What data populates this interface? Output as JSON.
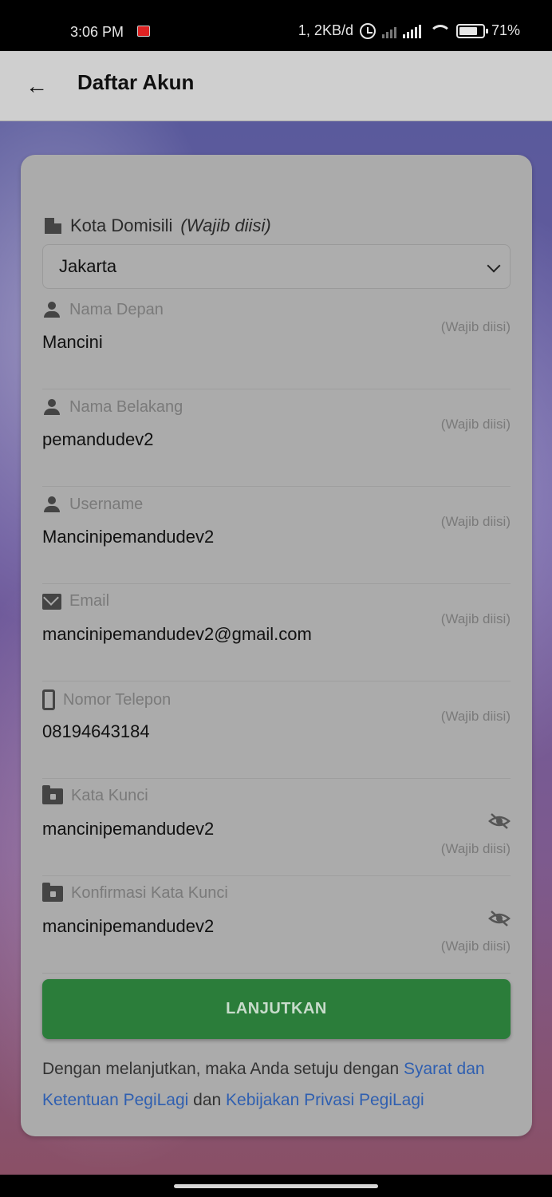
{
  "status_bar": {
    "time": "3:06 PM",
    "network_speed": "1, 2KB/d",
    "battery": "71%"
  },
  "app_bar": {
    "title": "Daftar Akun",
    "back_icon": "arrow-left-icon"
  },
  "form": {
    "city": {
      "label": "Kota Domisili",
      "required_note": "(Wajib diisi)",
      "value": "Jakarta",
      "icon": "building-icon"
    },
    "fields": [
      {
        "label": "Nama Depan",
        "value": "Mancini",
        "required": "(Wajib diisi)",
        "icon": "person-icon"
      },
      {
        "label": "Nama Belakang",
        "value": "pemandudev2",
        "required": "(Wajib diisi)",
        "icon": "person-icon"
      },
      {
        "label": "Username",
        "value": "Mancinipemandudev2",
        "required": "(Wajib diisi)",
        "icon": "person-icon"
      },
      {
        "label": "Email",
        "value": "mancinipemandudev2@gmail.com",
        "required": "(Wajib diisi)",
        "icon": "mail-icon"
      },
      {
        "label": "Nomor Telepon",
        "value": "08194643184",
        "required": "(Wajib diisi)",
        "icon": "phone-icon"
      },
      {
        "label": "Kata Kunci",
        "value": "mancinipemandudev2",
        "required": "(Wajib diisi)",
        "icon": "folder-lock-icon"
      },
      {
        "label": "Konfirmasi Kata Kunci",
        "value": "mancinipemandudev2",
        "required": "(Wajib diisi)",
        "icon": "folder-lock-icon"
      }
    ],
    "submit_label": "LANJUTKAN",
    "terms": {
      "prefix": "Dengan melanjutkan, maka Anda setuju dengan ",
      "link1": "Syarat dan Ketentuan PegiLagi",
      "middle": " dan ",
      "link2": "Kebijakan Privasi PegiLagi"
    }
  },
  "colors": {
    "primary_button": "#2b7d3a",
    "link": "#2f5fb0"
  }
}
